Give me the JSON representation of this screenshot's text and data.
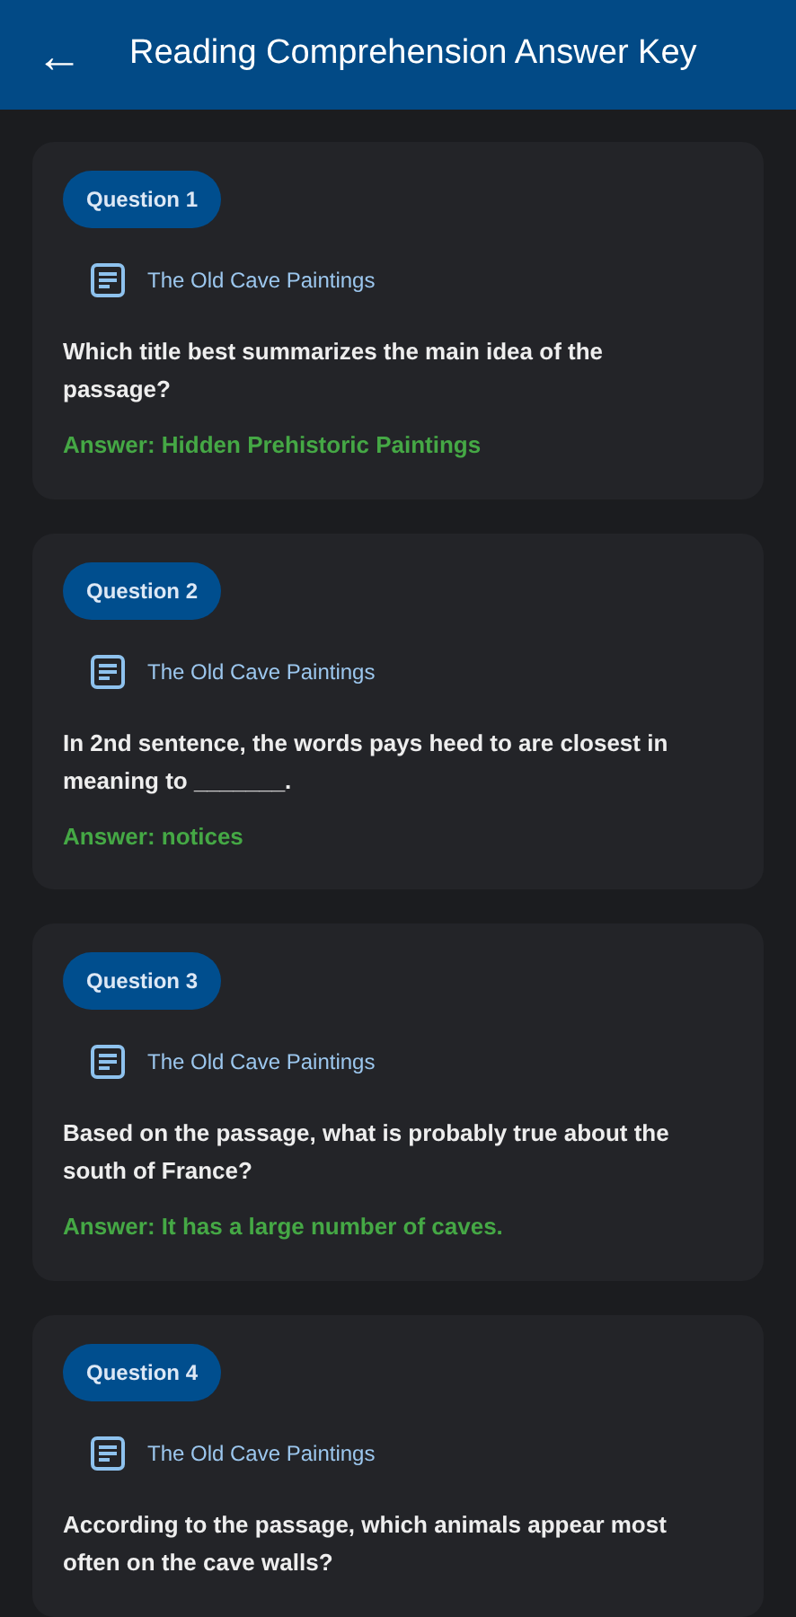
{
  "header": {
    "back_icon": "←",
    "title": "Reading Comprehension Answer Key"
  },
  "questions": [
    {
      "badge": "Question 1",
      "source": "The Old Cave Paintings",
      "question": "Which title best summarizes the main idea of the passage?",
      "answer": "Answer: Hidden Prehistoric Paintings"
    },
    {
      "badge": "Question 2",
      "source": "The Old Cave Paintings",
      "question": "In 2nd sentence, the words pays heed to are closest in meaning to _______.",
      "answer": "Answer: notices"
    },
    {
      "badge": "Question 3",
      "source": "The Old Cave Paintings",
      "question": "Based on the passage, what is probably true about the south of France?",
      "answer": "Answer: It has a large number of caves."
    },
    {
      "badge": "Question 4",
      "source": "The Old Cave Paintings",
      "question": "According to the passage, which animals appear most often on the cave walls?"
    }
  ]
}
